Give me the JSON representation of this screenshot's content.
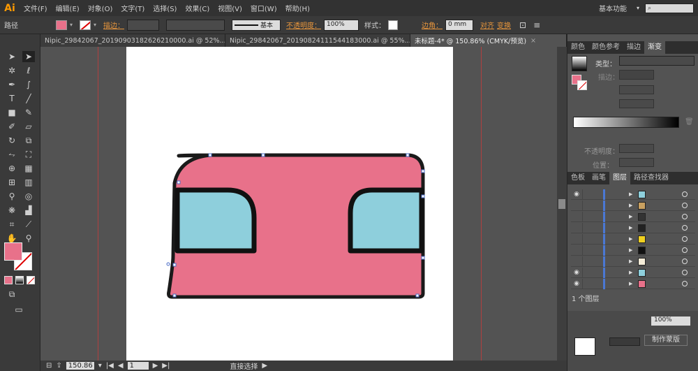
{
  "app": {
    "logo": "Ai",
    "workspace": "基本功能",
    "search_placeholder": ""
  },
  "menu": [
    "文件(F)",
    "编辑(E)",
    "对象(O)",
    "文字(T)",
    "选择(S)",
    "效果(C)",
    "视图(V)",
    "窗口(W)",
    "帮助(H)"
  ],
  "control": {
    "object_label": "路径",
    "stroke_label": "描边：",
    "brush_label": "基本",
    "opacity_label": "不透明度：",
    "opacity_value": "100%",
    "style_label": "样式：",
    "corner_label": "边角：",
    "corner_value": "0 mm",
    "align_label": "对齐",
    "transform_label": "变换",
    "fill_color": "#e8718a"
  },
  "tabs": [
    {
      "label": "Nipic_29842067_20190903182626210000.ai @ 52%...",
      "close": "×"
    },
    {
      "label": "Nipic_29842067_20190824111544183000.ai @ 55%...",
      "close": "×"
    },
    {
      "label": "未标题-4* @ 150.86% (CMYK/预览)",
      "close": "×"
    }
  ],
  "status": {
    "zoom": "150.86",
    "page": "1",
    "tool": "直接选择"
  },
  "gradient_panel": {
    "tabs": [
      "颜色",
      "颜色参考",
      "描边",
      "渐变"
    ],
    "type_label": "类型：",
    "stroke_label": "描边：",
    "opacity_label": "不透明度：",
    "position_label": "位置："
  },
  "layers_panel": {
    "tabs": [
      "色板",
      "画笔",
      "图层",
      "路径查找器"
    ],
    "count": "1 个图层",
    "rows": [
      {
        "visible": true,
        "thumb": "#8ecfdc"
      },
      {
        "visible": false,
        "thumb": "#c8a060"
      },
      {
        "visible": false,
        "thumb": "#333333"
      },
      {
        "visible": false,
        "thumb": "#222222"
      },
      {
        "visible": false,
        "thumb": "#f0d020"
      },
      {
        "visible": false,
        "thumb": "#111111"
      },
      {
        "visible": false,
        "thumb": "#f4ecd8"
      },
      {
        "visible": true,
        "thumb": "#8ecfdc"
      },
      {
        "visible": true,
        "thumb": "#e8718a"
      }
    ]
  },
  "bottom_panel": {
    "opacity_value": "100%",
    "make_mask_label": "制作蒙版"
  },
  "colors": {
    "pink": "#e8718a",
    "blue": "#8ecfdc",
    "outline": "#111111"
  }
}
